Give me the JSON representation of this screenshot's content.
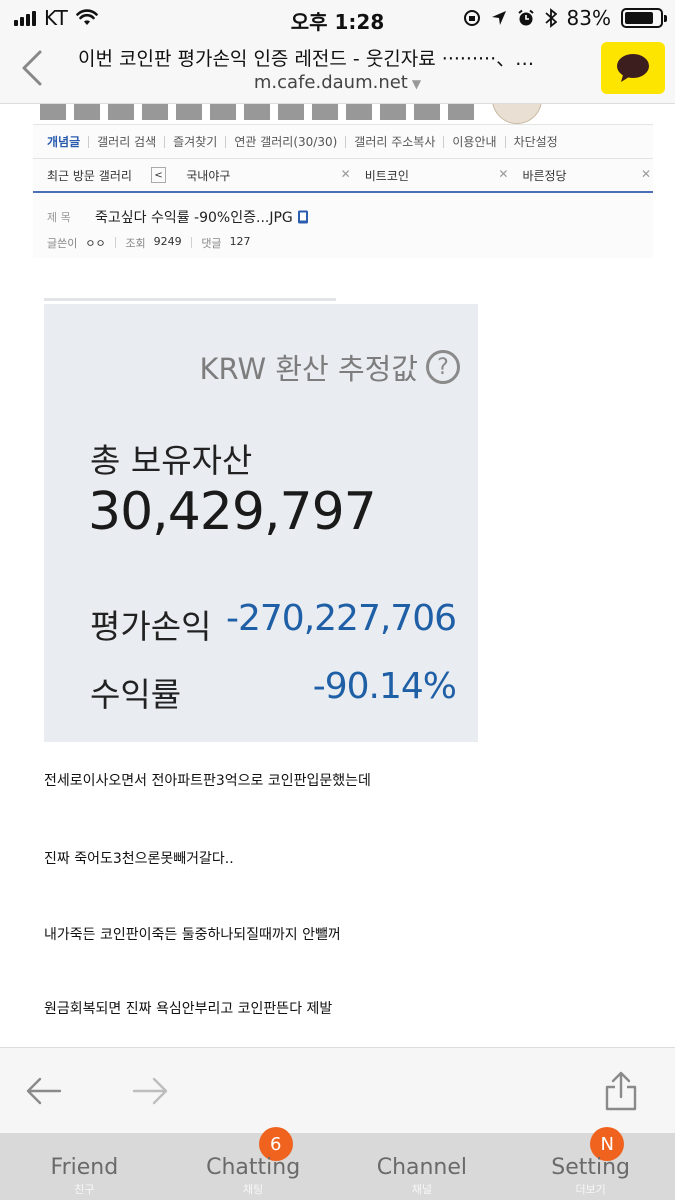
{
  "status_bar": {
    "carrier": "KT",
    "time": "오후 1:28",
    "battery": "83%",
    "battery_level": 0.83
  },
  "header": {
    "title": "이번 코인판 평가손익 인증 레전드 - 웃긴자료 ·········、…",
    "url": "m.cafe.daum.net"
  },
  "cafe": {
    "nav": [
      "개념글",
      "갤러리 검색",
      "즐겨찾기",
      "연관 갤러리(30/30)",
      "갤러리 주소복사",
      "이용안내",
      "차단설정"
    ],
    "recent_label": "최근 방문 갤러리",
    "recent_tabs": [
      "국내야구",
      "비트코인",
      "바른정당"
    ],
    "subject_label": "제 목",
    "subject": "죽고싶다 수익률 -90%인증...JPG",
    "author_label": "글쓴이",
    "author": "ㅇㅇ",
    "views_label": "조회",
    "views": "9249",
    "comments_label": "댓글",
    "comments": "127"
  },
  "krw_card": {
    "estimate_label": "KRW 환산 추정값",
    "total_label": "총 보유자산",
    "total_value": "30,429,797",
    "pnl_label": "평가손익",
    "pnl_value": "-270,227,706",
    "rate_label": "수익률",
    "rate_value": "-90.14%"
  },
  "paragraphs": [
    "전세로이사오면서 전아파트판3억으로 코인판입문했는데",
    "진짜 죽어도3천으론못빼거갈다..",
    "내가죽든 코인판이죽든 둘중하나되질때까지 안뺄꺼",
    "원금회복되면 진짜 욕심안부리고 코인판뜬다 제발"
  ],
  "tabbar": {
    "friend": "Friend",
    "friend_sub": "친구",
    "chatting": "Chatting",
    "chatting_sub": "채팅",
    "chatting_badge": "6",
    "channel": "Channel",
    "channel_sub": "채널",
    "setting": "Setting",
    "setting_sub": "더보기",
    "setting_badge": "N"
  },
  "colors": {
    "kakao_yellow": "#fee500",
    "negative_blue": "#1f5fa6",
    "badge_orange": "#f0631f"
  }
}
